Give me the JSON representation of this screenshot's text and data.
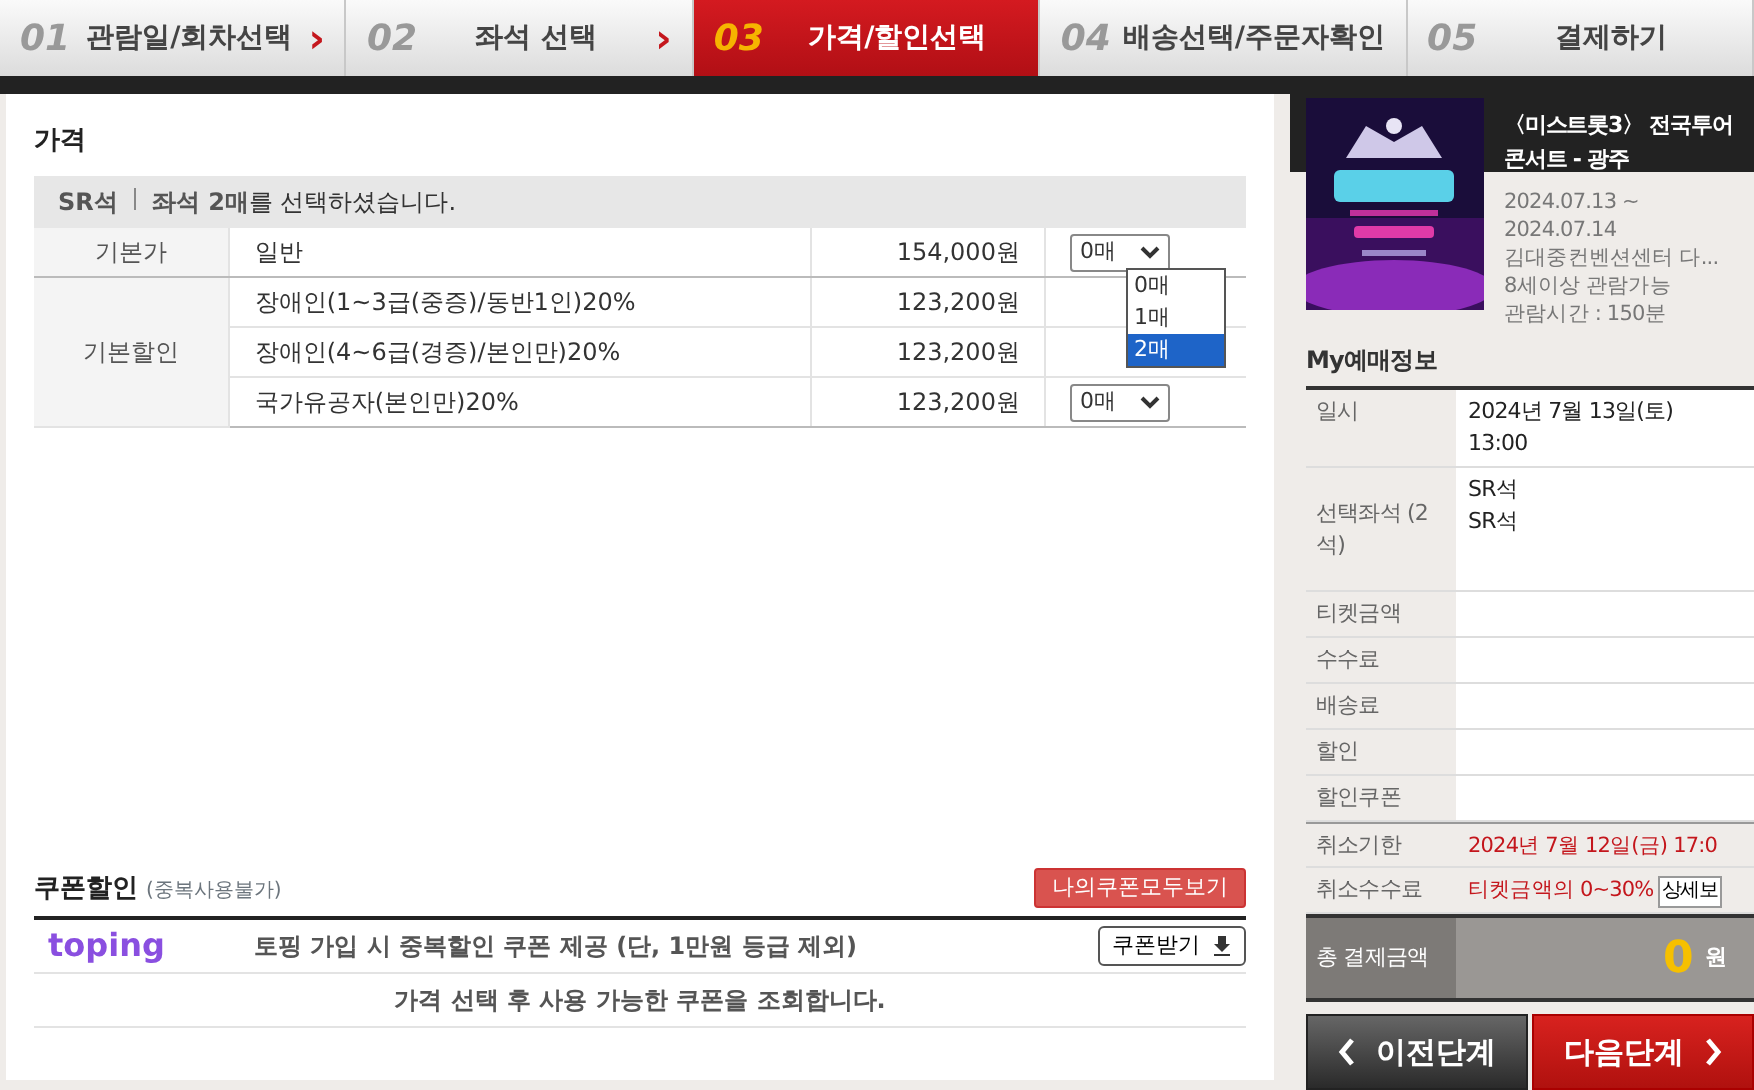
{
  "steps": [
    {
      "number": "01",
      "label": "관람일/회차선택",
      "arrow": "›",
      "selected": false
    },
    {
      "number": "02",
      "label": "좌석 선택",
      "arrow": "›",
      "selected": false
    },
    {
      "number": "03",
      "label": "가격/할인선택",
      "selected": true
    },
    {
      "number": "04",
      "label": "배송선택/주문자확인",
      "selected": false
    },
    {
      "number": "05",
      "label": "결제하기",
      "selected": false
    }
  ],
  "price": {
    "title": "가격",
    "grade": "SR석",
    "notice": "**좌석 2매**를 선택하셨습니다.",
    "groups": [
      {
        "category": "기본가",
        "rows": [
          {
            "name": "일반",
            "price": "154,000원",
            "quantity": "0매",
            "options": [
              {
                "label": "0매",
                "selected": false
              },
              {
                "label": "1매",
                "selected": false
              },
              {
                "label": "2매",
                "selected": true
              }
            ]
          }
        ]
      },
      {
        "category": "기본할인",
        "rows": [
          {
            "name": "장애인(1~3급(중증)/동반1인)20%",
            "price": "123,200원"
          },
          {
            "name": "장애인(4~6급(경증)/본인만)20%",
            "price": "123,200원"
          },
          {
            "name": "국가유공자(본인만)20%",
            "price": "123,200원",
            "quantity": "0매"
          }
        ]
      }
    ]
  },
  "coupon": {
    "title": "쿠폰할인",
    "note": "(중복사용불가)",
    "all_button": "나의쿠폰모두보기",
    "logo": "toping",
    "promo": "토핑 가입 시 중복할인 쿠폰 제공 (단, 1만원 등급 제외)",
    "get_button": "쿠폰받기",
    "message": "가격 선택 후 사용 가능한 쿠폰을 조회합니다."
  },
  "show": {
    "title": "〈미스트롯3〉 전국투어 콘서트 - 광주",
    "period": "2024.07.13 ~ 2024.07.14",
    "venue": "김대중컨벤션센터 다...",
    "age": "8세이상 관람가능",
    "runtime": "관람시간 : 150분"
  },
  "my_booking": {
    "title": "My예매정보",
    "rows": [
      {
        "label": "일시",
        "values": [
          "2024년 7월 13일(토) 13:00"
        ],
        "kind": "plain"
      },
      {
        "label": "선택좌석 (2석)",
        "values": [
          "SR석",
          "SR석"
        ],
        "kind": "tall"
      },
      {
        "label": "티켓금액",
        "kind": "plain"
      },
      {
        "label": "수수료",
        "kind": "plain"
      },
      {
        "label": "배송료",
        "kind": "plain"
      },
      {
        "label": "할인",
        "kind": "plain"
      },
      {
        "label": "할인쿠폰",
        "kind": "plain"
      },
      {
        "label": "취소기한",
        "values": [
          "2024년 7월 12일(금) 17:0"
        ],
        "kind": "alert"
      },
      {
        "label": "취소수수료",
        "values": [
          "티켓금액의 0~30%"
        ],
        "kind": "alert",
        "button": "상세보"
      }
    ],
    "total": {
      "label": "총 결제금액",
      "amount": "0",
      "unit": "원"
    }
  },
  "nav": {
    "prev": "이전단계",
    "next": "다음단계"
  }
}
